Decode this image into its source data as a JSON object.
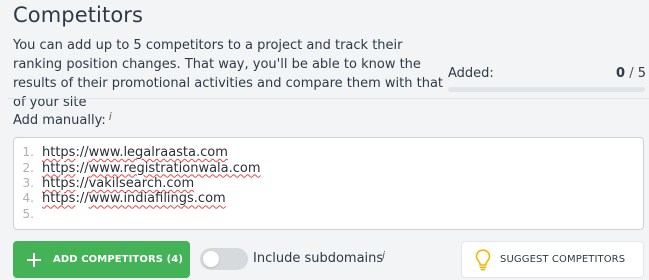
{
  "section": {
    "title": "Competitors",
    "description": "You can add up to 5 competitors to a project and track their ranking position changes. That way, you'll be able to know the results of their promotional activities and compare them with that of your site"
  },
  "added": {
    "label": "Added:",
    "count": "0",
    "separator": "/",
    "max": "5",
    "progress_fraction": 0.0
  },
  "manual": {
    "label": "Add manually:",
    "info_icon": "i",
    "lines": [
      {
        "num": "1.",
        "text": "https://www.legalraasta.com"
      },
      {
        "num": "2.",
        "text": "https://www.registrationwala.com"
      },
      {
        "num": "3.",
        "text": "https://vakilsearch.com"
      },
      {
        "num": "4.",
        "text": "https://www.indiafilings.com"
      },
      {
        "num": "5.",
        "text": ""
      }
    ]
  },
  "actions": {
    "add_label": "ADD COMPETITORS (4)",
    "include_subdomains_label": "Include subdomains",
    "include_subdomains_info": "i",
    "include_subdomains_on": false,
    "suggest_label": "SUGGEST COMPETITORS"
  },
  "colors": {
    "accent_green": "#44b358",
    "bulb_yellow": "#f2b705",
    "spell_error": "#e34b4b"
  }
}
